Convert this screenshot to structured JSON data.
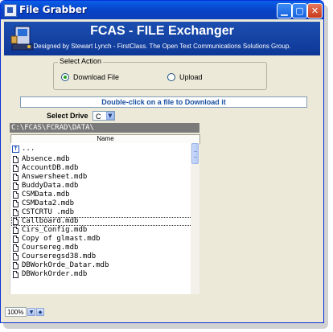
{
  "window": {
    "title": "File Grabber",
    "minimize_icon": "minimize-icon",
    "maximize_icon": "maximize-icon",
    "close_icon": "close-icon"
  },
  "banner": {
    "title": "FCAS - FILE Exchanger",
    "subtitle": "Designed by Stewart Lynch - FirstClass. The Open Text Communications Solutions Group.",
    "icon": "computer-icon"
  },
  "action": {
    "legend": "Select Action",
    "download_label": "Download File",
    "upload_label": "Upload",
    "selected": "Download File"
  },
  "hint": "Double-click on a file to Download it",
  "drive": {
    "label": "Select Drive",
    "value": "C"
  },
  "path": "C:\\FCAS\\FCRAD\\DATA\\",
  "list": {
    "column_header": "Name",
    "up_entry": "...",
    "files": [
      "Absence.mdb",
      "AccountDB.mdb",
      "Answersheet.mdb",
      "BuddyData.mdb",
      "CSMData.mdb",
      "CSMData2.mdb",
      "CSTCRTU .mdb",
      "Callboard.mdb",
      "Cirs_Config.mdb",
      "Copy of glmast.mdb",
      "Coursereg.mdb",
      "Courseregsd38.mdb",
      "DBWorkOrde_Datar.mdb",
      "DBWorkOrder.mdb"
    ],
    "selected_file": "Callboard.mdb"
  },
  "zoom": {
    "value": "100%"
  },
  "colors": {
    "titlebar": "#0A5FE8",
    "banner": "#1C4FB0",
    "window_bg": "#ECE9D8",
    "hint_text": "#1A4FA0",
    "path_bg": "#7A7A7A"
  }
}
